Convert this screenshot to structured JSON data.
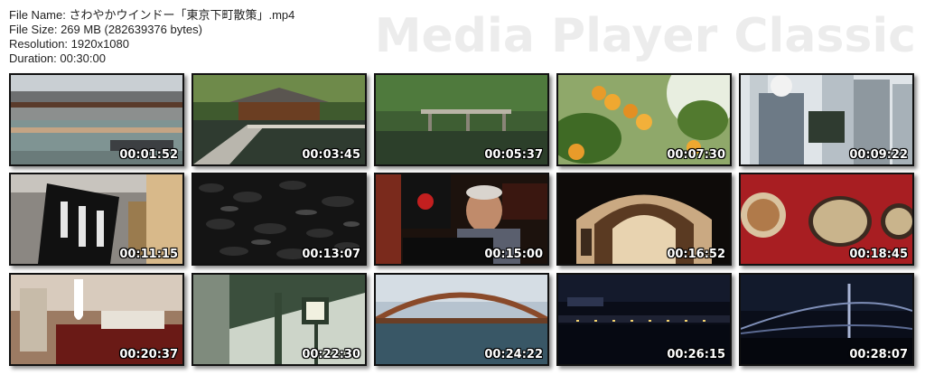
{
  "info": {
    "file_name": "File Name: さわやかウインドー「東京下町散策」.mp4",
    "file_size": "File Size: 269 MB (282639376 bytes)",
    "resolution": "Resolution: 1920x1080",
    "duration": "Duration: 00:30:00"
  },
  "watermark": "Media Player Classic",
  "thumbnails": [
    {
      "timestamp": "00:01:52",
      "scene": "canal-boats"
    },
    {
      "timestamp": "00:03:45",
      "scene": "pavilion-bridge"
    },
    {
      "timestamp": "00:05:37",
      "scene": "garden-bridge"
    },
    {
      "timestamp": "00:07:30",
      "scene": "osmanthus-flowers"
    },
    {
      "timestamp": "00:09:22",
      "scene": "painter-towers"
    },
    {
      "timestamp": "00:11:15",
      "scene": "shop-signboard"
    },
    {
      "timestamp": "00:13:07",
      "scene": "tea-leaves"
    },
    {
      "timestamp": "00:15:00",
      "scene": "craftsman"
    },
    {
      "timestamp": "00:16:52",
      "scene": "arch-passage"
    },
    {
      "timestamp": "00:18:45",
      "scene": "satsuma-buttons"
    },
    {
      "timestamp": "00:20:37",
      "scene": "museum-kimono"
    },
    {
      "timestamp": "00:22:30",
      "scene": "iron-bridge-lamp"
    },
    {
      "timestamp": "00:24:22",
      "scene": "eitai-bridge"
    },
    {
      "timestamp": "00:26:15",
      "scene": "night-river"
    },
    {
      "timestamp": "00:28:07",
      "scene": "rainbow-bridge-night"
    }
  ]
}
